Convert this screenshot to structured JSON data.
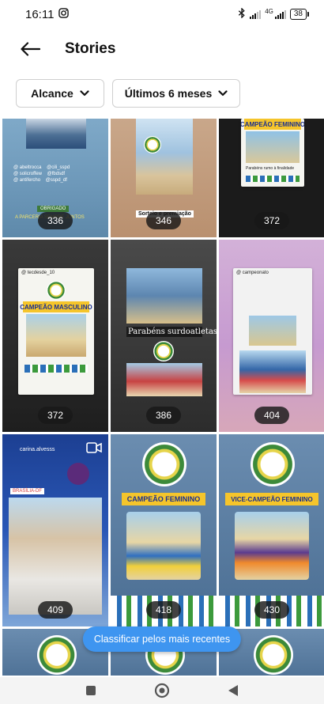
{
  "status_bar": {
    "time": "16:11",
    "battery": "38",
    "network": "4G"
  },
  "header": {
    "title": "Stories"
  },
  "filters": [
    {
      "label": "Alcance"
    },
    {
      "label": "Últimos 6 meses"
    }
  ],
  "tiles": [
    {
      "count": "336",
      "caption": "A PARCERIA SEMPRE JUNTOS",
      "tag": "OBRIGADO"
    },
    {
      "count": "346",
      "caption": "Sorteio e premiação"
    },
    {
      "count": "372",
      "banner": "CAMPEÃO FEMININO",
      "caption": "Parabéns rumo à finalidade"
    },
    {
      "count": "372",
      "banner": "CAMPEÃO MASCULINO"
    },
    {
      "count": "386",
      "caption": "Parabéns surdoatletas"
    },
    {
      "count": "404"
    },
    {
      "count": "409",
      "user": "carina.alvesss",
      "location": "BRASÍLIA-DF"
    },
    {
      "count": "418",
      "banner": "CAMPEÃO FEMININO"
    },
    {
      "count": "430",
      "banner": "VICE-CAMPEÃO FEMININO"
    },
    {},
    {},
    {}
  ],
  "sort_pill": {
    "label": "Classificar pelos mais recentes"
  },
  "colors": {
    "accent": "#3e95f0",
    "banner": "#f5c52b",
    "banner_text": "#1a2f8f"
  }
}
